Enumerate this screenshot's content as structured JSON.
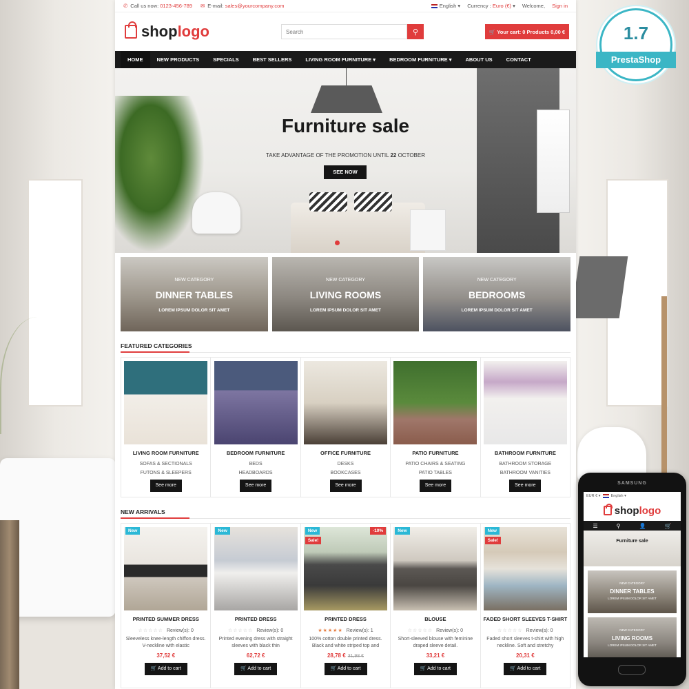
{
  "topbar": {
    "call_label": "Call us now:",
    "phone": "0123-456-789",
    "email_label": "E-mail:",
    "email": "sales@yourcompany.com",
    "language": "English",
    "currency_label": "Currency :",
    "currency": "Euro (€)",
    "welcome": "Welcome,",
    "signin": "Sign in"
  },
  "header": {
    "logo_part1": "shop",
    "logo_part2": "logo",
    "search_placeholder": "Search",
    "cart": "Your cart: 0 Products 0,00 €"
  },
  "nav": [
    "HOME",
    "NEW PRODUCTS",
    "SPECIALS",
    "BEST SELLERS",
    "LIVING ROOM FURNITURE ▾",
    "BEDROOM FURNITURE ▾",
    "ABOUT US",
    "CONTACT"
  ],
  "hero": {
    "title": "Furniture sale",
    "subtitle_pre": "TAKE ADVANTAGE OF THE PROMOTION UNTIL ",
    "subtitle_bold": "22",
    "subtitle_post": " OCTOBER",
    "cta": "SEE NOW"
  },
  "banners": [
    {
      "pre": "NEW CATEGORY",
      "title": "DINNER TABLES",
      "sub": "LOREM IPSUM DOLOR SIT AMET"
    },
    {
      "pre": "NEW CATEGORY",
      "title": "LIVING ROOMS",
      "sub": "LOREM IPSUM DOLOR SIT AMET"
    },
    {
      "pre": "NEW CATEGORY",
      "title": "BEDROOMS",
      "sub": "LOREM IPSUM DOLOR SIT AMET"
    }
  ],
  "featured": {
    "heading": "FEATURED CATEGORIES",
    "more": "See more",
    "items": [
      {
        "title": "LIVING ROOM FURNITURE",
        "sub1": "SOFAS & SECTIONALS",
        "sub2": "FUTONS & SLEEPERS"
      },
      {
        "title": "BEDROOM FURNITURE",
        "sub1": "BEDS",
        "sub2": "HEADBOARDS"
      },
      {
        "title": "OFFICE FURNITURE",
        "sub1": "DESKS",
        "sub2": "BOOKCASES"
      },
      {
        "title": "PATIO FURNITURE",
        "sub1": "PATIO CHAIRS & SEATING",
        "sub2": "PATIO TABLES"
      },
      {
        "title": "BATHROOM FURNITURE",
        "sub1": "BATHROOM STORAGE",
        "sub2": "BATHROOM VANITIES"
      }
    ]
  },
  "arrivals": {
    "heading": "NEW ARRIVALS",
    "add": "Add to cart",
    "items": [
      {
        "new": "New",
        "sale": "",
        "discount": "",
        "title": "PRINTED SUMMER DRESS",
        "stars": "☆☆☆☆☆",
        "rating": 0,
        "reviews": "Review(s): 0",
        "desc": "Sleeveless knee-length chiffon dress. V-neckline with elastic",
        "price": "37,52 €",
        "old_price": ""
      },
      {
        "new": "New",
        "sale": "",
        "discount": "",
        "title": "PRINTED DRESS",
        "stars": "☆☆☆☆☆",
        "rating": 0,
        "reviews": "Review(s): 0",
        "desc": "Printed evening dress with straight sleeves with black thin",
        "price": "62,72 €",
        "old_price": ""
      },
      {
        "new": "New",
        "sale": "Sale!",
        "discount": "-10%",
        "title": "PRINTED DRESS",
        "stars": "★★★★★",
        "rating": 5,
        "reviews": "Review(s): 1",
        "desc": "100% cotton double printed dress. Black and white striped top and",
        "price": "28,78 €",
        "old_price": "31,98 €"
      },
      {
        "new": "New",
        "sale": "",
        "discount": "",
        "title": "BLOUSE",
        "stars": "☆☆☆☆☆",
        "rating": 0,
        "reviews": "Review(s): 0",
        "desc": "Short-sleeved blouse with feminine draped sleeve detail.",
        "price": "33,21 €",
        "old_price": ""
      },
      {
        "new": "New",
        "sale": "Sale!",
        "discount": "",
        "title": "FADED SHORT SLEEVES T-SHIRT",
        "stars": "☆☆☆☆☆",
        "rating": 0,
        "reviews": "Review(s): 0",
        "desc": "Faded short sleeves t-shirt with high neckline. Soft and stretchy",
        "price": "20,31 €",
        "old_price": ""
      }
    ]
  },
  "badge": {
    "version": "1.7",
    "label": "PrestaShop"
  },
  "phone": {
    "brand": "SAMSUNG",
    "currency": "EUR € ▾",
    "language": "English ▾",
    "hero_title": "Furniture sale",
    "banners": [
      {
        "pre": "NEW CATEGORY",
        "title": "DINNER TABLES",
        "sub": "LOREM IPSUM DOLOR SIT AMET"
      },
      {
        "pre": "NEW CATEGORY",
        "title": "LIVING ROOMS",
        "sub": "LOREM IPSUM DOLOR SIT AMET"
      }
    ]
  },
  "colors": {
    "accent": "#e03c3c",
    "nav": "#1a1a1a",
    "new_tag": "#2bb8d6",
    "badge": "#3bb6c5"
  }
}
